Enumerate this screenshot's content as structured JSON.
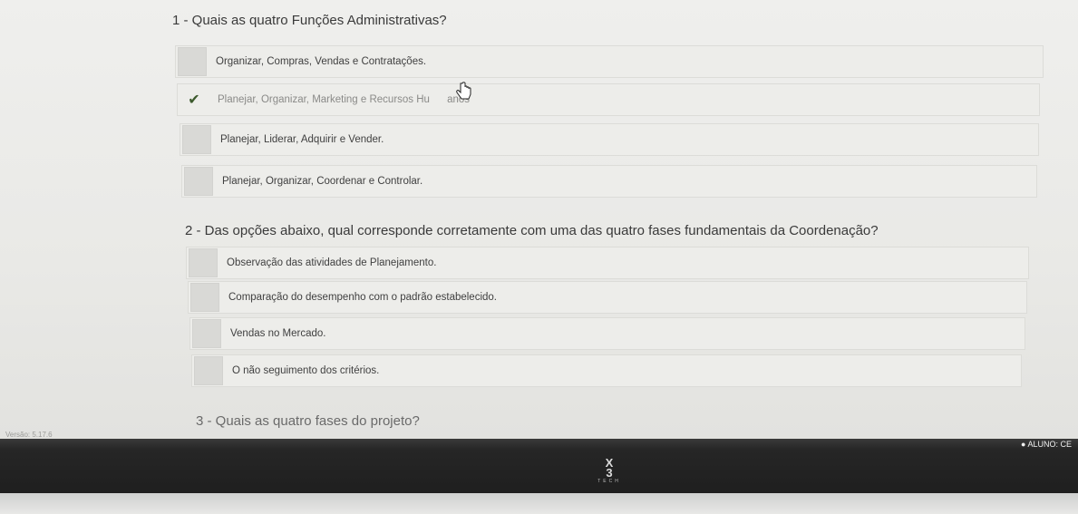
{
  "questions": [
    {
      "text": "1 - Quais as quatro Funções Administrativas?",
      "options": [
        {
          "label": "Organizar, Compras, Vendas e Contratações."
        },
        {
          "label": "Planejar, Organizar, Marketing e Recursos Hu",
          "label_tail": "anos",
          "selected": true
        },
        {
          "label": "Planejar, Liderar, Adquirir e Vender."
        },
        {
          "label": "Planejar, Organizar, Coordenar e Controlar."
        }
      ]
    },
    {
      "text": "2 - Das opções abaixo, qual corresponde corretamente com uma das quatro fases fundamentais da Coordenação?",
      "options": [
        {
          "label": "Observação das atividades de Planejamento."
        },
        {
          "label": "Comparação do desempenho com o padrão estabelecido."
        },
        {
          "label": "Vendas no Mercado."
        },
        {
          "label": "O não seguimento dos critérios."
        }
      ]
    },
    {
      "text": "3 - Quais as quatro fases do projeto?"
    }
  ],
  "footer": {
    "version": "Versão: 5.17.6",
    "user": "ALUNO: CE"
  },
  "monitor": {
    "brand_line1": "X",
    "brand_line2": "3",
    "brand_line3": "TECH"
  },
  "colors": {
    "checkmark": "#3c5a2c",
    "bezel": "#1f1f1f"
  }
}
